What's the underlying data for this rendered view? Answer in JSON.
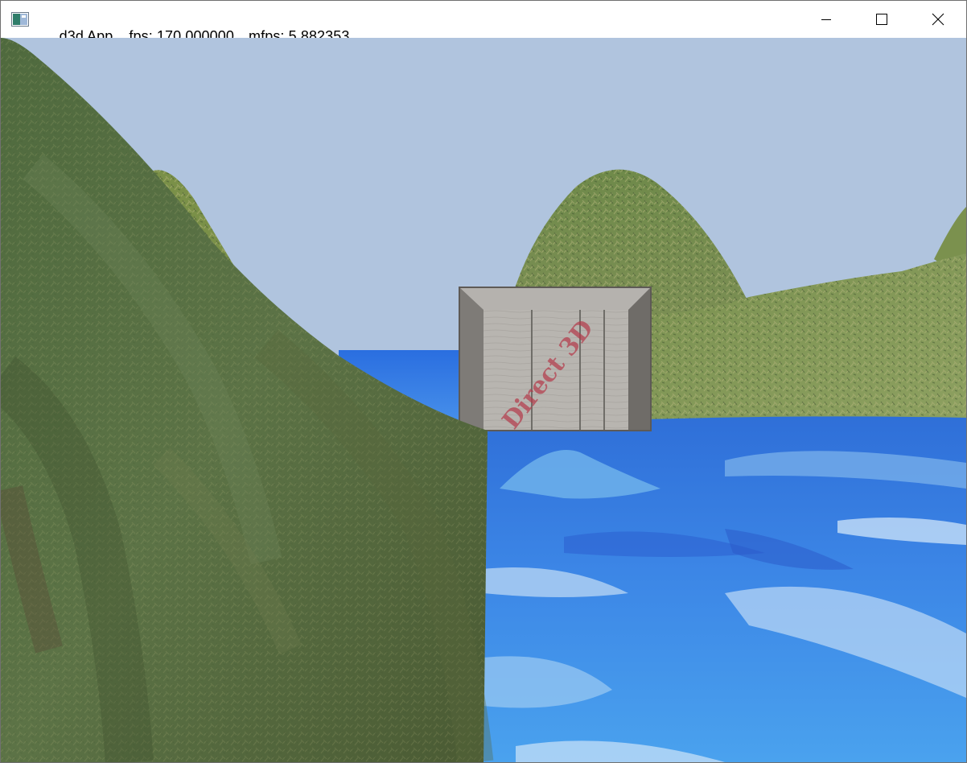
{
  "window": {
    "app_name": "d3d App",
    "fps": "fps: 170.000000",
    "mfps": "mfps: 5.882353",
    "controls": {
      "minimize_icon": "minimize-icon",
      "maximize_icon": "maximize-icon",
      "close_icon": "close-icon"
    }
  },
  "scene": {
    "sky_color": "#b0c4de",
    "water_color": "#3a7fe0",
    "terrain_color": "#5f7a45",
    "crate_stamp": "Direct 3D"
  }
}
